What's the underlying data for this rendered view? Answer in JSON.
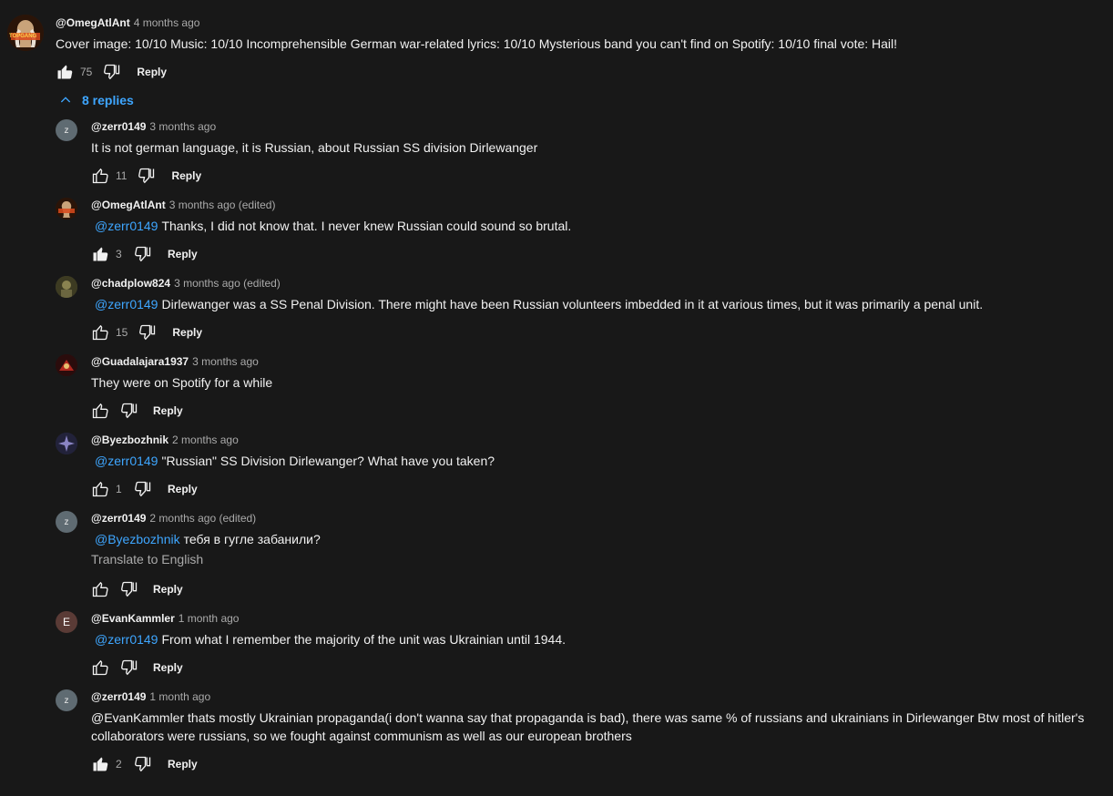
{
  "main_comment": {
    "author": "@OmegAtlAnt",
    "time": "4 months ago",
    "avatar_text": "TOPGANG",
    "text": "Cover image: 10/10 Music: 10/10 Incomprehensible German war-related lyrics: 10/10 Mysterious band you can't find on Spotify: 10/10 final vote: Hail!",
    "likes": "75",
    "reply_label": "Reply"
  },
  "replies_toggle": {
    "label": "8 replies"
  },
  "replies": [
    {
      "author": "@zerr0149",
      "time": "3 months ago",
      "avatar_letter": "z",
      "mention": "",
      "text": "It is not german language, it is Russian, about Russian SS division Dirlewanger",
      "likes": "11",
      "reply_label": "Reply"
    },
    {
      "author": "@OmegAtlAnt",
      "time": "3 months ago (edited)",
      "mention": "@zerr0149",
      "text": "Thanks, I did not know that. I never knew Russian could sound so brutal.",
      "likes": "3",
      "reply_label": "Reply"
    },
    {
      "author": "@chadplow824",
      "time": "3 months ago (edited)",
      "mention": "@zerr0149",
      "text": "Dirlewanger was a SS Penal Division. There might have been Russian volunteers imbedded in it at various times, but it was primarily a penal unit.",
      "likes": "15",
      "reply_label": "Reply"
    },
    {
      "author": "@Guadalajara1937",
      "time": "3 months ago",
      "mention": "",
      "text": "They were on Spotify for a while",
      "likes": "",
      "reply_label": "Reply"
    },
    {
      "author": "@Byezbozhnik",
      "time": "2 months ago",
      "mention": "@zerr0149",
      "text": "\"Russian\" SS Division Dirlewanger? What have you taken?",
      "likes": "1",
      "reply_label": "Reply"
    },
    {
      "author": "@zerr0149",
      "time": "2 months ago (edited)",
      "avatar_letter": "z",
      "mention": "@Byezbozhnik",
      "text": "тебя в гугле забанили?",
      "translate": "Translate to English",
      "likes": "",
      "reply_label": "Reply"
    },
    {
      "author": "@EvanKammler",
      "time": "1 month ago",
      "avatar_letter": "E",
      "mention": "@zerr0149",
      "text": "From what I remember the majority of the unit was Ukrainian until 1944.",
      "likes": "",
      "reply_label": "Reply"
    },
    {
      "author": "@zerr0149",
      "time": "1 month ago",
      "avatar_letter": "z",
      "mention": "",
      "text": "@EvanKammler thats mostly Ukrainian propaganda(i don't wanna say that propaganda is bad), there was same % of russians and ukrainians in Dirlewanger Btw most of hitler's collaborators were russians, so we fought against communism as well as our european brothers",
      "likes": "2",
      "reply_label": "Reply"
    }
  ],
  "colors": {
    "background": "#181818",
    "text": "#f1f1f1",
    "secondary": "#aaaaaa",
    "link": "#3ea6ff"
  }
}
